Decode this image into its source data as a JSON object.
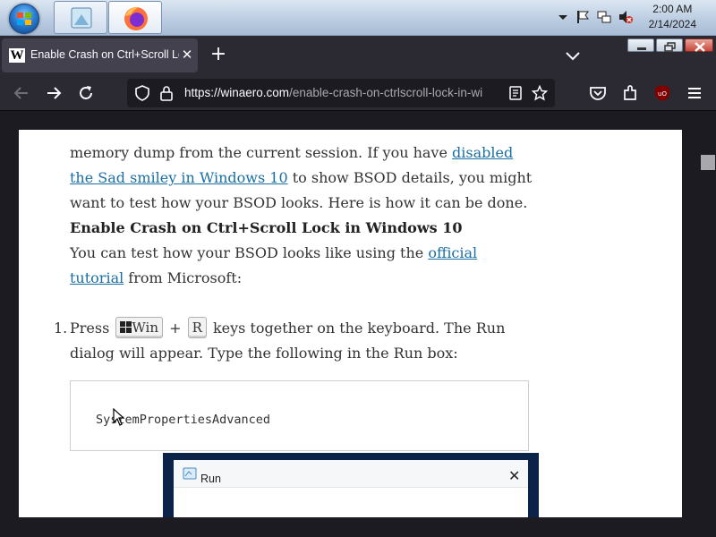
{
  "taskbar": {
    "clock_time": "2:00 AM",
    "clock_date": "2/14/2024",
    "icons": [
      "start-orb-icon",
      "photo-viewer-icon",
      "firefox-icon",
      "chevron-up-icon",
      "flag-icon",
      "network-icon",
      "volume-muted-icon"
    ]
  },
  "browser": {
    "tab_title": "Enable Crash on Ctrl+Scroll Lock",
    "tab_favicon": "W",
    "tab_close": "✕",
    "new_tab": "+",
    "url_host": "https://winaero.com",
    "url_path": "/enable-crash-on-ctrlscroll-lock-in-wi"
  },
  "article": {
    "para1_text1": "memory dump from the current session. If you have ",
    "para1_link": "disabled the Sad smiley in Windows 10",
    "para1_text2": " to show BSOD details, you might want to test how your BSOD looks. Here is how it can be done.",
    "heading": "Enable Crash on Ctrl+Scroll Lock in Windows 10",
    "para2_text1": "You can test how your BSOD looks like using the ",
    "para2_link": "official tutorial",
    "para2_text2": " from Microsoft:",
    "step1_num": "1.",
    "step1_pre": "Press ",
    "key_win": "Win",
    "key_plus": " + ",
    "key_r": "R",
    "step1_post": " keys together on the keyboard. The Run dialog will appear. Type the following in the Run box:",
    "code": "SystemPropertiesAdvanced",
    "run_title": "Run",
    "run_close": "✕"
  },
  "colors": {
    "link": "#1a6fa3",
    "browser_chrome": "#2b2a33",
    "page_bg": "#1c1b22"
  }
}
